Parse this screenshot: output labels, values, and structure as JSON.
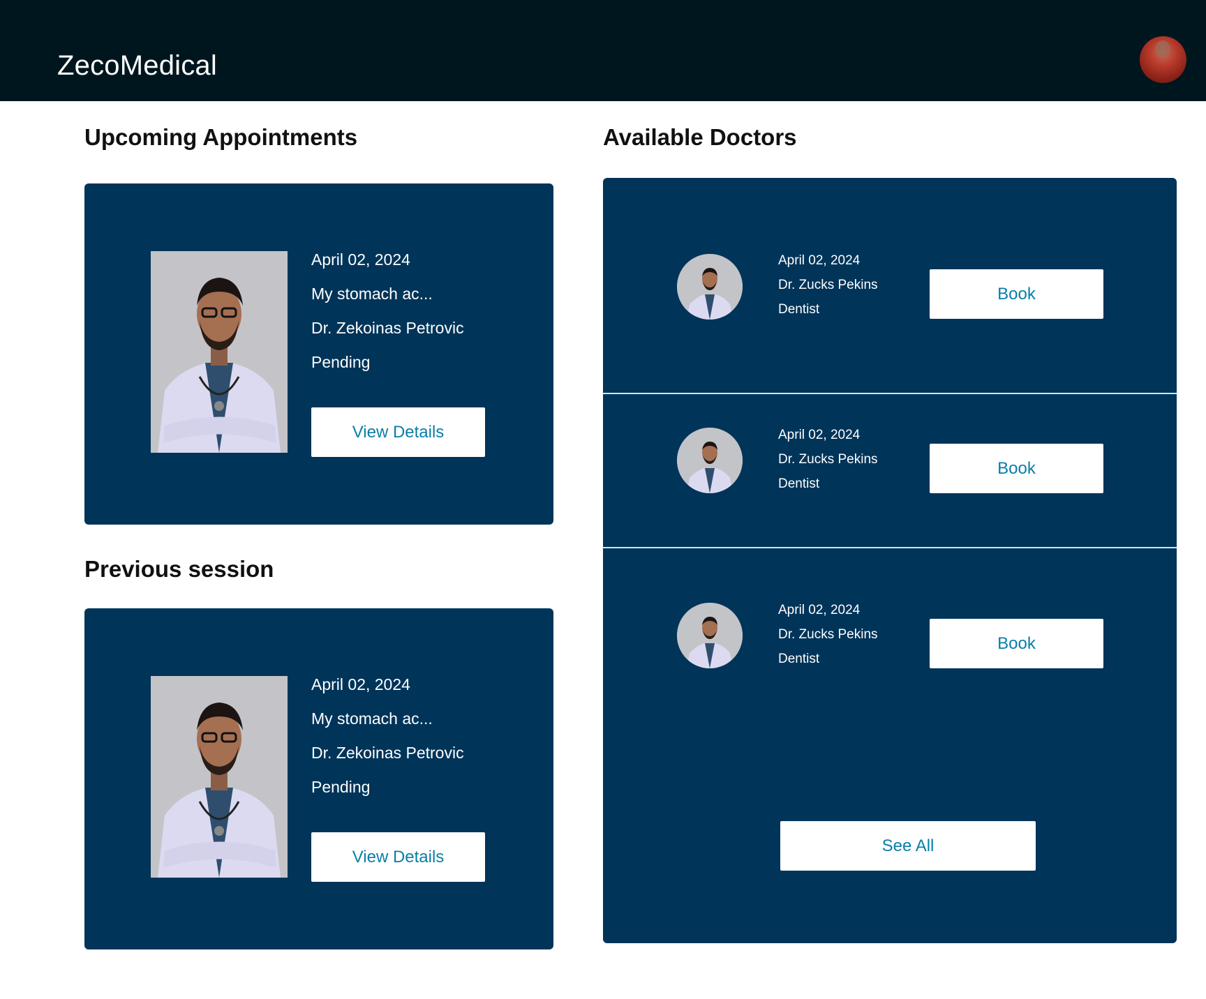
{
  "app": {
    "title": "ZecoMedical"
  },
  "user": {
    "avatar": "user-avatar"
  },
  "upcoming": {
    "heading": "Upcoming Appointments",
    "card": {
      "date": "April 02, 2024",
      "reason": "My stomach ac...",
      "doctor": "Dr. Zekoinas Petrovic",
      "status": "Pending",
      "button": "View Details"
    }
  },
  "previous": {
    "heading": "Previous session",
    "card": {
      "date": "April 02, 2024",
      "reason": "My stomach ac...",
      "doctor": "Dr. Zekoinas Petrovic",
      "status": "Pending",
      "button": "View Details"
    }
  },
  "doctors": {
    "heading": "Available Doctors",
    "items": [
      {
        "date": "April 02, 2024",
        "name": "Dr. Zucks Pekins",
        "specialty": "Dentist",
        "button": "Book"
      },
      {
        "date": "April 02, 2024",
        "name": "Dr. Zucks Pekins",
        "specialty": "Dentist",
        "button": "Book"
      },
      {
        "date": "April 02, 2024",
        "name": "Dr. Zucks Pekins",
        "specialty": "Dentist",
        "button": "Book"
      }
    ],
    "see_all": "See All"
  },
  "colors": {
    "header_bg": "#00161e",
    "card_bg": "#003459",
    "button_text": "#0a7ea8"
  }
}
